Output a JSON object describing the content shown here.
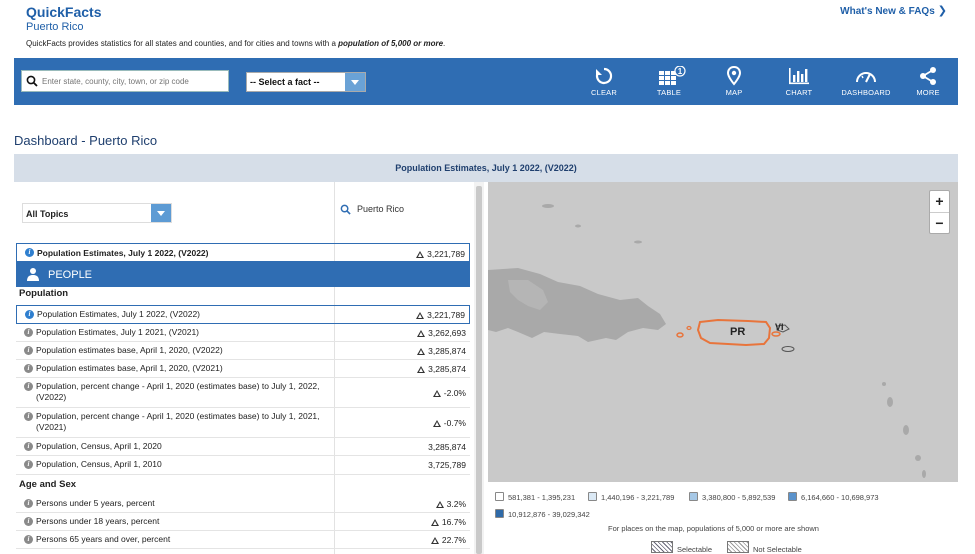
{
  "header": {
    "brand": "QuickFacts",
    "location": "Puerto Rico",
    "tagline_prefix": "QuickFacts provides statistics for all states and counties, and for cities and towns with a ",
    "tagline_emph": "population of 5,000 or more",
    "tagline_suffix": ".",
    "whats_new": "What's New & FAQs",
    "whats_new_icon": "chevron-right-icon"
  },
  "toolbar": {
    "search_placeholder": "Enter state, county, city, town, or zip code",
    "select_fact": "-- Select a fact --",
    "tools": [
      {
        "label": "CLEAR",
        "icon": "refresh-icon"
      },
      {
        "label": "TABLE",
        "icon": "table-icon",
        "badge": "1"
      },
      {
        "label": "MAP",
        "icon": "map-pin-icon"
      },
      {
        "label": "CHART",
        "icon": "bar-chart-icon"
      },
      {
        "label": "DASHBOARD",
        "icon": "gauge-icon"
      },
      {
        "label": "MORE",
        "icon": "share-icon"
      }
    ]
  },
  "dashboard": {
    "title": "Dashboard - Puerto Rico",
    "fact_heading": "Population Estimates, July 1 2022, (V2022)"
  },
  "table": {
    "topic_select": "All Topics",
    "place_header": "Puerto Rico",
    "selected_fact": {
      "label": "Population Estimates, July 1 2022, (V2022)",
      "value": "3,221,789"
    },
    "section": "PEOPLE",
    "groups": [
      {
        "title": "Population",
        "rows": [
          {
            "label": "Population Estimates, July 1 2022, (V2022)",
            "value": "3,221,789",
            "flag": true
          },
          {
            "label": "Population Estimates, July 1 2021, (V2021)",
            "value": "3,262,693",
            "flag": true
          },
          {
            "label": "Population estimates base, April 1, 2020, (V2022)",
            "value": "3,285,874",
            "flag": true
          },
          {
            "label": "Population estimates base, April 1, 2020, (V2021)",
            "value": "3,285,874",
            "flag": true
          },
          {
            "label": "Population, percent change - April 1, 2020 (estimates base) to July 1, 2022, (V2022)",
            "value": "-2.0%",
            "flag": true
          },
          {
            "label": "Population, percent change - April 1, 2020 (estimates base) to July 1, 2021, (V2021)",
            "value": "-0.7%",
            "flag": true
          },
          {
            "label": "Population, Census, April 1, 2020",
            "value": "3,285,874",
            "flag": false
          },
          {
            "label": "Population, Census, April 1, 2010",
            "value": "3,725,789",
            "flag": false
          }
        ]
      },
      {
        "title": "Age and Sex",
        "rows": [
          {
            "label": "Persons under 5 years, percent",
            "value": "3.2%",
            "flag": true
          },
          {
            "label": "Persons under 18 years, percent",
            "value": "16.7%",
            "flag": true
          },
          {
            "label": "Persons 65 years and over, percent",
            "value": "22.7%",
            "flag": true
          }
        ]
      }
    ]
  },
  "map": {
    "labels": [
      "PR",
      "VI"
    ],
    "zoom_in": "+",
    "zoom_out": "−",
    "colors": {
      "water": "#c9c9c9",
      "land": "#a9a9a9",
      "highlight": "#e8743b"
    },
    "legend": [
      {
        "range": "581,381 - 1,395,231",
        "color": "#ffffff"
      },
      {
        "range": "1,440,196 - 3,221,789",
        "color": "#dbe9f5"
      },
      {
        "range": "3,380,800 - 5,892,539",
        "color": "#a6c8e6"
      },
      {
        "range": "6,164,660 - 10,698,973",
        "color": "#5b93cc"
      },
      {
        "range": "10,912,876 - 39,029,342",
        "color": "#2f6aa8"
      }
    ],
    "note": "For places on the map, populations of 5,000 or more are shown",
    "selectable": "Selectable",
    "not_selectable": "Not Selectable"
  }
}
